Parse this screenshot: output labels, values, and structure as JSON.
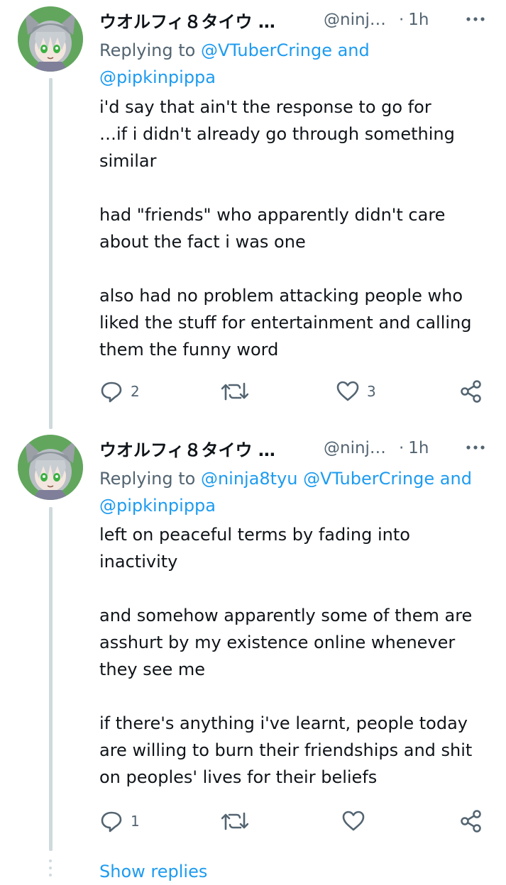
{
  "tweets": [
    {
      "display_name": "ウオルフィ８タイウ …",
      "handle": "@ninj…",
      "separator": "·",
      "time": "1h",
      "replying_prefix": "Replying to ",
      "mentions_line1": "@VTuberCringe and",
      "mentions_line2": "@pipkinpippa",
      "body_lines": [
        "i'd say that ain't the response to go for",
        "…if i didn't already go through something",
        "similar",
        "",
        "had \"friends\" who apparently didn't care",
        "about the fact i was one",
        "",
        "also had no problem attacking people who",
        "liked the stuff for entertainment and calling",
        "them the funny word"
      ],
      "reply_count": "2",
      "retweet_count": "",
      "like_count": "3"
    },
    {
      "display_name": "ウオルフィ８タイウ …",
      "handle": "@ninj…",
      "separator": "·",
      "time": "1h",
      "replying_prefix": "Replying to ",
      "mentions_line1": "@ninja8tyu @VTuberCringe and",
      "mentions_line2": "@pipkinpippa",
      "body_lines": [
        "left on peaceful terms by fading into",
        "inactivity",
        "",
        "and somehow apparently some of them are",
        "asshurt by my existence online whenever",
        "they see me",
        "",
        "if there's anything i've learnt, people today",
        "are willing to burn their friendships and shit",
        "on peoples' lives for their beliefs"
      ],
      "reply_count": "1",
      "retweet_count": "",
      "like_count": ""
    }
  ],
  "show_replies_label": "Show replies",
  "icons": {
    "reply": "reply-icon",
    "retweet": "retweet-icon",
    "like": "heart-icon",
    "share": "share-icon",
    "more": "more-icon"
  },
  "colors": {
    "link": "#1d9bf0",
    "secondary_text": "#536471",
    "primary_text": "#0f1419",
    "thread_line": "#cfd9de",
    "avatar_bg": "#62a65e"
  }
}
